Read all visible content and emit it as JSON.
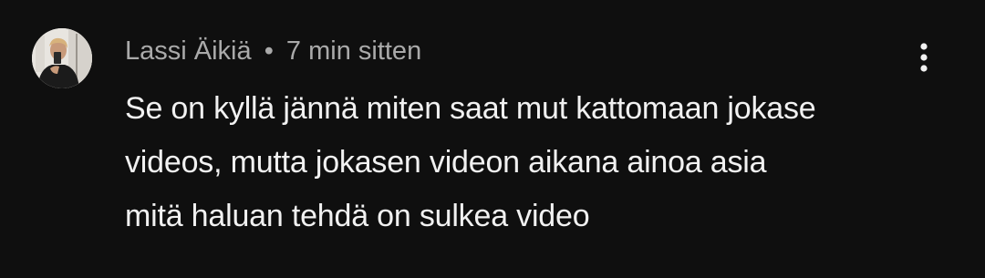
{
  "comment": {
    "author": "Lassi Äikiä",
    "separator": "•",
    "timestamp": "7 min sitten",
    "text_lines": [
      "Se on kyllä jännä miten saat mut kattomaan jokase",
      "videos, mutta jokasen videon aikana ainoa asia",
      "mitä haluan tehdä on sulkea video"
    ],
    "avatar_icon": "user-avatar-photo",
    "menu_icon": "more-vertical-icon"
  },
  "colors": {
    "background": "#0f0f0f",
    "meta_text": "#aaaaaa",
    "body_text": "#f1f1f1",
    "icon": "#f1f1f1"
  }
}
